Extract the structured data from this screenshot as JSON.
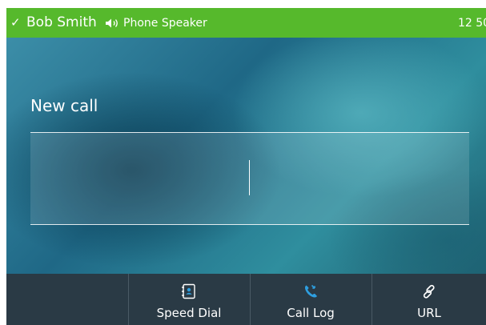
{
  "status": {
    "check_glyph": "✓",
    "account": "Bob Smith",
    "audio_icon": "speaker-icon",
    "audio_device": "Phone Speaker",
    "time": "12 50"
  },
  "dial": {
    "title": "New call",
    "value": ""
  },
  "softkeys": [
    {
      "label": "",
      "icon": ""
    },
    {
      "label": "Speed Dial",
      "icon": "speed-dial-icon"
    },
    {
      "label": "Call Log",
      "icon": "call-log-icon"
    },
    {
      "label": "URL",
      "icon": "link-icon"
    }
  ],
  "colors": {
    "status_bar": "#56b92c",
    "softkey_bar": "#2a3a45",
    "call_log_icon": "#2e9fe0"
  }
}
